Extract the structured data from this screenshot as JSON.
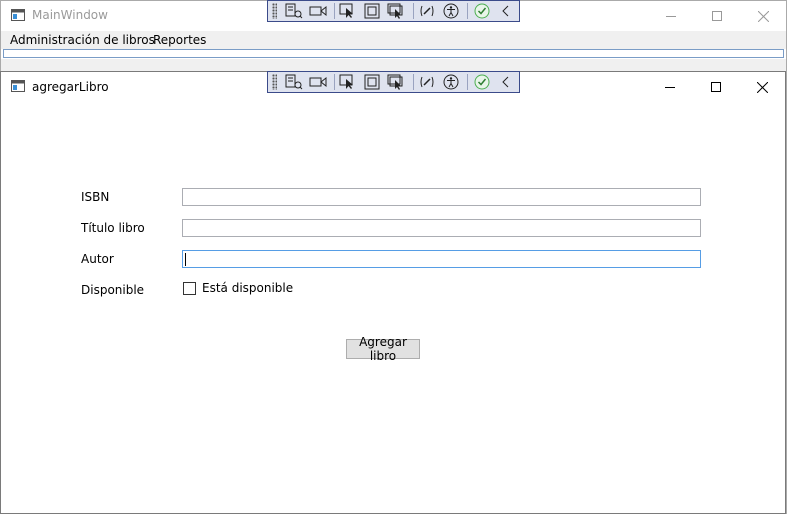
{
  "main_window": {
    "title": "MainWindow",
    "menu": [
      {
        "label": "Administración de libros"
      },
      {
        "label": "Reportes"
      }
    ]
  },
  "child_window": {
    "title": "agregarLibro",
    "form": {
      "isbn_label": "ISBN",
      "isbn_value": "",
      "title_label": "Título libro",
      "title_value": "",
      "author_label": "Autor",
      "author_value": "",
      "available_label": "Disponible",
      "available_checkbox_label": "Está disponible",
      "available_checked": false,
      "submit_label": "Agregar libro"
    }
  },
  "debug_toolbar_icons": [
    "go-to-live-visual-tree-icon",
    "record-icon",
    "select-element-icon",
    "display-layout-adorners-icon",
    "track-focus-icon",
    "binding-failures-icon",
    "accessibility-icon",
    "hot-reload-ok-icon",
    "collapse-icon"
  ],
  "colors": {
    "toolbar_bg": "#dfe3ef",
    "toolbar_border": "#3b4b8a",
    "focus_border": "#569de5",
    "hot_reload_green": "#4caf50"
  }
}
